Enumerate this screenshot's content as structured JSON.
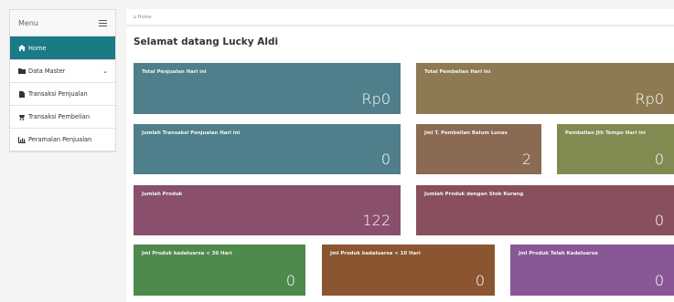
{
  "sidebar": {
    "header": "Menu",
    "items": [
      {
        "label": "Home",
        "icon": "home-icon"
      },
      {
        "label": "Data Master",
        "icon": "folder-icon"
      },
      {
        "label": "Transaksi Penjualan",
        "icon": "file-icon"
      },
      {
        "label": "Transaksi Pembelian",
        "icon": "cart-icon"
      },
      {
        "label": "Peramalan Penjualan",
        "icon": "chart-icon"
      }
    ]
  },
  "breadcrumb": "Home",
  "welcome": "Selamat datang Lucky Aldi",
  "cards": [
    {
      "title": "Total Penjualan Hari ini",
      "value": "Rp0",
      "color": "#4f7f8a"
    },
    {
      "title": "Total Pembelian Hari ini",
      "value": "Rp0",
      "color": "#8d7a52"
    },
    {
      "title": "Jumlah Transaksi Penjualan Hari ini",
      "value": "0",
      "color": "#4f7f8a"
    },
    {
      "title": "Jml T. Pembelian Belum Lunas",
      "value": "2",
      "color": "#8a6a52"
    },
    {
      "title": "Pembelian Jth Tempo Hari ini",
      "value": "0",
      "color": "#808b52"
    },
    {
      "title": "Jumlah Produk",
      "value": "122",
      "color": "#8a4f6c"
    },
    {
      "title": "Jumlah Produk dengan Stok Kurang",
      "value": "0",
      "color": "#8a4f5c"
    },
    {
      "title": "Jml Produk kadaluarsa < 30 Hari",
      "value": "0",
      "color": "#4f8a4d"
    },
    {
      "title": "Jml Produk kadaluarsa < 10 Hari",
      "value": "0",
      "color": "#8a5530"
    },
    {
      "title": "Jml Produk Telah Kadaluarsa",
      "value": "0",
      "color": "#8a5796"
    }
  ]
}
